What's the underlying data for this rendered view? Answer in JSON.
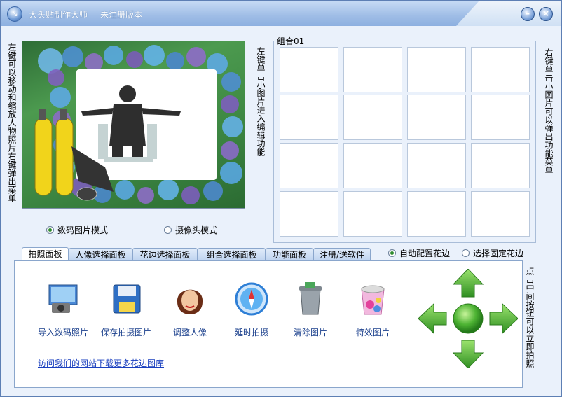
{
  "window": {
    "title": "大头贴制作大师",
    "subtitle": "未注册版本"
  },
  "left_hint": "左键可以移动和缩放人物照片右键弹出菜单",
  "middle_hint": "左键单击小图片进入编辑功能",
  "right_hint": "右键单击小图片可以弹出功能菜单",
  "arrow_hint": "点击中间按钮可以立即拍照",
  "modes": {
    "digital": "数码图片模式",
    "camera": "摄像头模式",
    "selected": "digital"
  },
  "group": {
    "label": "组合01"
  },
  "tabs": [
    {
      "label": "拍照面板"
    },
    {
      "label": "人像选择面板"
    },
    {
      "label": "花边选择面板"
    },
    {
      "label": "组合选择面板"
    },
    {
      "label": "功能面板"
    },
    {
      "label": "注册/送软件"
    }
  ],
  "frame_options": {
    "auto": "自动配置花边",
    "fixed": "选择固定花边",
    "selected": "auto"
  },
  "tools": [
    {
      "label": "导入数码照片",
      "icon": "import-photo-icon"
    },
    {
      "label": "保存拍摄图片",
      "icon": "floppy-save-icon"
    },
    {
      "label": "调整人像",
      "icon": "portrait-icon"
    },
    {
      "label": "延时拍摄",
      "icon": "compass-timer-icon"
    },
    {
      "label": "清除图片",
      "icon": "trash-bin-icon"
    },
    {
      "label": "特效图片",
      "icon": "effects-bucket-icon"
    }
  ],
  "website_link": "访问我们的网站下载更多花边图库",
  "colors": {
    "accent_green": "#3fae2e",
    "title_blue": "#8db0e0",
    "link_blue": "#1a3fbf"
  }
}
